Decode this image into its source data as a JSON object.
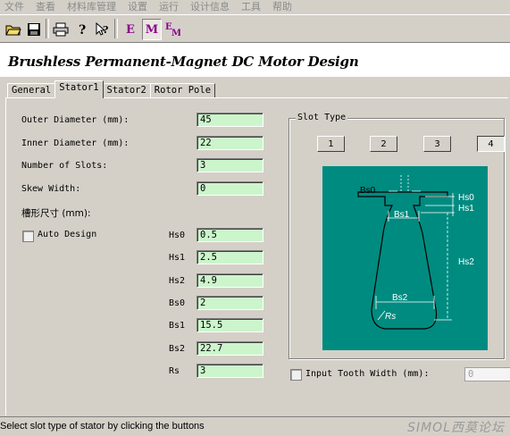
{
  "menu": [
    "文件",
    "查看",
    "材料库管理",
    "设置",
    "运行",
    "设计信息",
    "工具",
    "帮助"
  ],
  "toolbar": {
    "icons": [
      "open-folder-icon",
      "save-icon",
      "print-icon",
      "help-icon",
      "context-help-icon"
    ],
    "e_label": "E",
    "m_label": "M",
    "em_label": "EM"
  },
  "title": "Brushless Permanent-Magnet DC Motor Design",
  "tabs": [
    "General",
    "Stator1",
    "Stator2",
    "Rotor Pole"
  ],
  "active_tab": "Stator1",
  "fields": {
    "outer_diameter": {
      "label": "Outer Diameter (mm):",
      "value": "45"
    },
    "inner_diameter": {
      "label": "Inner Diameter (mm):",
      "value": "22"
    },
    "num_slots": {
      "label": "Number of Slots:",
      "value": "3"
    },
    "skew_width": {
      "label": "Skew Width:",
      "value": "0"
    }
  },
  "slot_dim_label": "槽形尺寸 (mm):",
  "auto_design_label": "Auto Design",
  "dims": [
    {
      "name": "Hs0",
      "value": "0.5"
    },
    {
      "name": "Hs1",
      "value": "2.5"
    },
    {
      "name": "Hs2",
      "value": "4.9"
    },
    {
      "name": "Bs0",
      "value": "2"
    },
    {
      "name": "Bs1",
      "value": "15.5"
    },
    {
      "name": "Bs2",
      "value": "22.7"
    },
    {
      "name": "Rs",
      "value": "3"
    }
  ],
  "slot_type": {
    "label": "Slot Type",
    "buttons": [
      "1",
      "2",
      "3",
      "4"
    ],
    "selected": "4",
    "diagram_bg": "#008b80",
    "diagram_labels": {
      "bs0": "Bs0",
      "hs0": "Hs0",
      "hs1": "Hs1",
      "bs1": "Bs1",
      "hs2": "Hs2",
      "bs2": "Bs2",
      "rs": "Rs"
    }
  },
  "input_tooth": {
    "label": "Input Tooth Width (mm):",
    "value": "0"
  },
  "status": "Select slot type of stator by clicking the buttons",
  "watermark": "SIMOL西莫论坛"
}
